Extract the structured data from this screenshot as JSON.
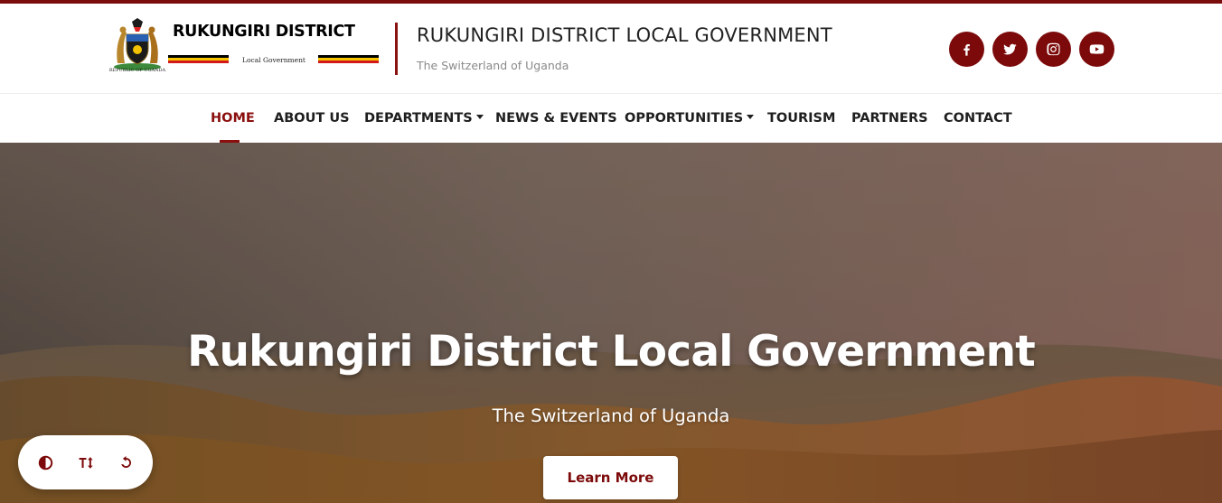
{
  "header": {
    "district_name": "RUKUNGIRI DISTRICT",
    "local_government_label": "Local Government",
    "coat_caption": "REPUBLIC OF UGANDA",
    "site_title": "RUKUNGIRI DISTRICT LOCAL GOVERNMENT",
    "tagline": "The Switzerland of Uganda",
    "social": [
      {
        "name": "facebook",
        "icon": "facebook-icon"
      },
      {
        "name": "twitter",
        "icon": "twitter-icon"
      },
      {
        "name": "instagram",
        "icon": "instagram-icon"
      },
      {
        "name": "youtube",
        "icon": "youtube-icon"
      }
    ]
  },
  "nav": {
    "items": [
      {
        "label": "HOME",
        "active": true
      },
      {
        "label": "ABOUT US"
      },
      {
        "label": "DEPARTMENTS",
        "dropdown": true
      },
      {
        "label": "NEWS & EVENTS"
      },
      {
        "label": "OPPORTUNITIES",
        "dropdown": true
      },
      {
        "label": "TOURISM"
      },
      {
        "label": "PARTNERS"
      },
      {
        "label": "CONTACT"
      }
    ]
  },
  "hero": {
    "title": "Rukungiri District Local Government",
    "subtitle": "The Switzerland of Uganda",
    "cta_label": "Learn More"
  },
  "accessibility": {
    "buttons": [
      {
        "icon": "contrast-icon"
      },
      {
        "icon": "text-resize-icon"
      },
      {
        "icon": "reset-icon"
      }
    ]
  },
  "colors": {
    "brand": "#7d0a0a",
    "active_nav": "#8b0f0f",
    "top_strip": "#7a0c0c"
  }
}
